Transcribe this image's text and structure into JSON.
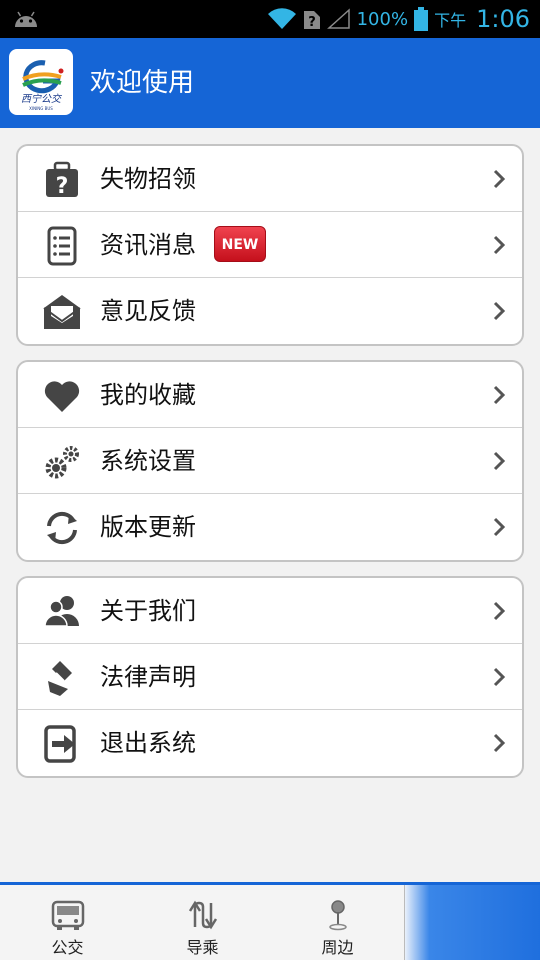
{
  "status_bar": {
    "battery": "100%",
    "ampm": "下午",
    "time": "1:06"
  },
  "header": {
    "title": "欢迎使用",
    "logo_text": "西宁公交",
    "logo_subtext": "XINING BUS"
  },
  "groups": [
    {
      "items": [
        {
          "label": "失物招领",
          "icon": "lost-luggage-icon"
        },
        {
          "label": "资讯消息",
          "icon": "news-document-icon",
          "badge": "NEW"
        },
        {
          "label": "意见反馈",
          "icon": "feedback-mail-icon"
        }
      ]
    },
    {
      "items": [
        {
          "label": "我的收藏",
          "icon": "heart-icon"
        },
        {
          "label": "系统设置",
          "icon": "gears-icon"
        },
        {
          "label": "版本更新",
          "icon": "refresh-icon"
        }
      ]
    },
    {
      "items": [
        {
          "label": "关于我们",
          "icon": "users-icon"
        },
        {
          "label": "法律声明",
          "icon": "law-icon"
        },
        {
          "label": "退出系统",
          "icon": "exit-icon"
        }
      ]
    }
  ],
  "bottom_nav": {
    "tabs": [
      {
        "label": "公交",
        "icon": "bus-icon"
      },
      {
        "label": "导乘",
        "icon": "transfer-icon"
      },
      {
        "label": "周边",
        "icon": "location-pin-icon"
      }
    ]
  },
  "colors": {
    "primary": "#1565d6",
    "badge": "#d81b27",
    "status_text": "#33b5e5"
  }
}
